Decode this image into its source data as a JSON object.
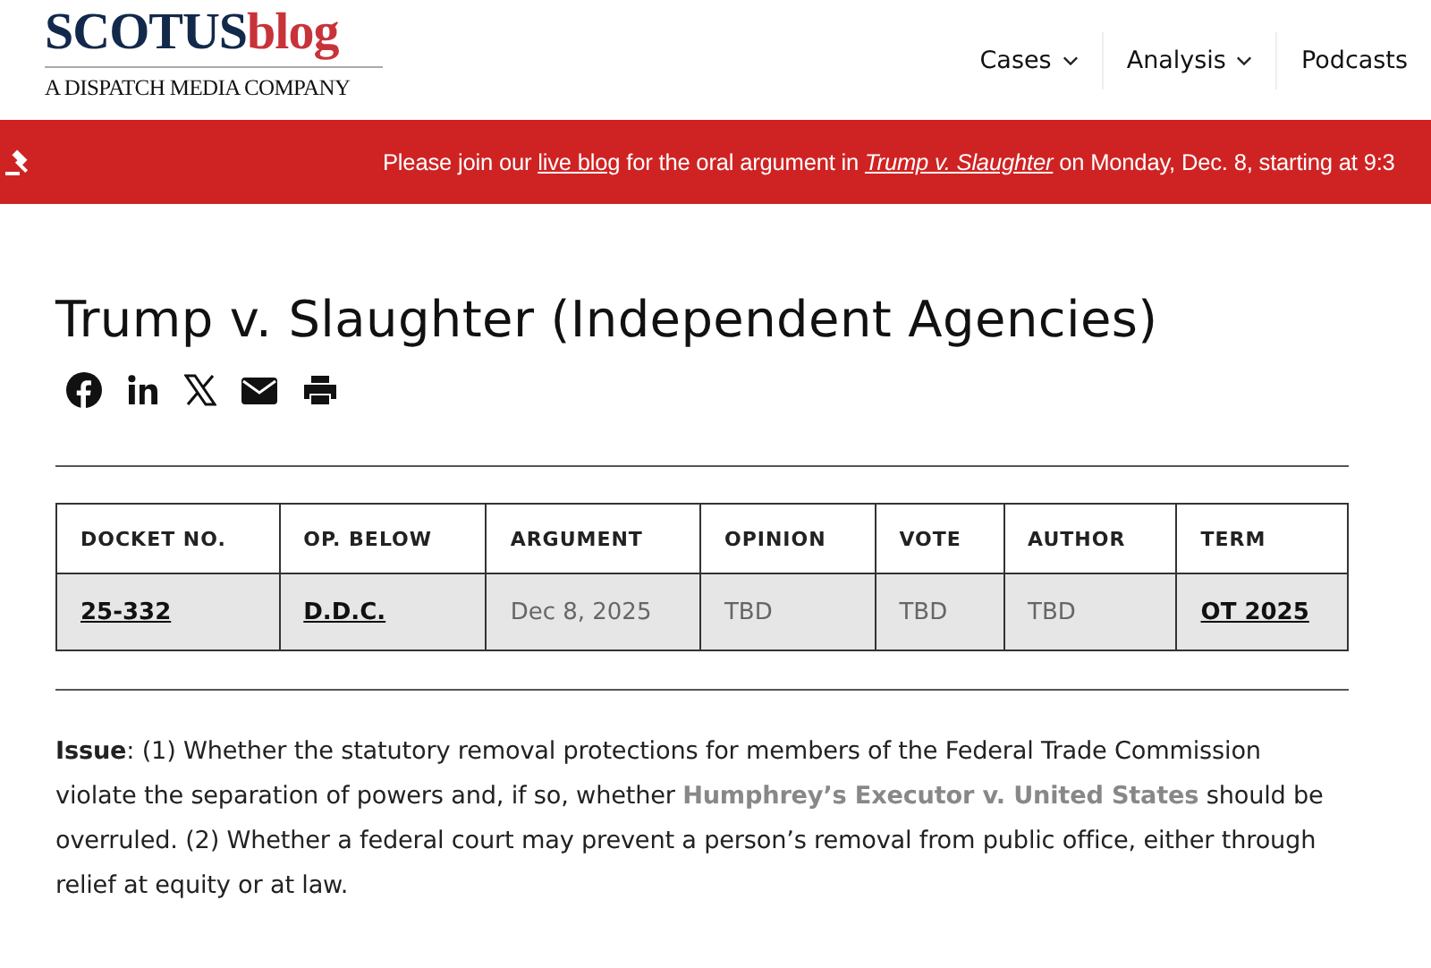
{
  "logo": {
    "main": "SCOTUS",
    "accent": "blog",
    "tagline": "A DISPATCH MEDIA COMPANY"
  },
  "nav": [
    {
      "label": "Cases",
      "dropdown": true
    },
    {
      "label": "Analysis",
      "dropdown": true
    },
    {
      "label": "Podcasts",
      "dropdown": false
    }
  ],
  "banner": {
    "parts": [
      {
        "kind": "text",
        "text": "Please join our "
      },
      {
        "kind": "link",
        "text": "live blog"
      },
      {
        "kind": "text",
        "text": " for the oral argument in "
      },
      {
        "kind": "italic_link",
        "text": "Trump v. Slaughter"
      },
      {
        "kind": "text",
        "text": " on Monday, Dec. 8, starting at 9:3"
      }
    ]
  },
  "title": "Trump v. Slaughter (Independent Agencies)",
  "share": [
    {
      "kind": "facebook"
    },
    {
      "kind": "linkedin"
    },
    {
      "kind": "x"
    },
    {
      "kind": "email"
    },
    {
      "kind": "print"
    }
  ],
  "table": {
    "columns": [
      "DOCKET NO.",
      "OP. BELOW",
      "ARGUMENT",
      "OPINION",
      "VOTE",
      "AUTHOR",
      "TERM"
    ],
    "row": [
      {
        "text": "25-332",
        "link": true
      },
      {
        "text": "D.D.C.",
        "link": true
      },
      {
        "text": "Dec 8, 2025",
        "link": false
      },
      {
        "text": "TBD",
        "link": false
      },
      {
        "text": "TBD",
        "link": false
      },
      {
        "text": "TBD",
        "link": false
      },
      {
        "text": "OT 2025",
        "link": true
      }
    ]
  },
  "issue": {
    "label": "Issue",
    "before": ": (1) Whether the statutory removal protections for members of the Federal Trade Commission violate the separation of powers and, if so, whether ",
    "link": "Humphrey’s Executor v. United States",
    "after": " should be overruled. (2) Whether a federal court may prevent a person’s removal from public office, either through relief at equity or at law."
  }
}
